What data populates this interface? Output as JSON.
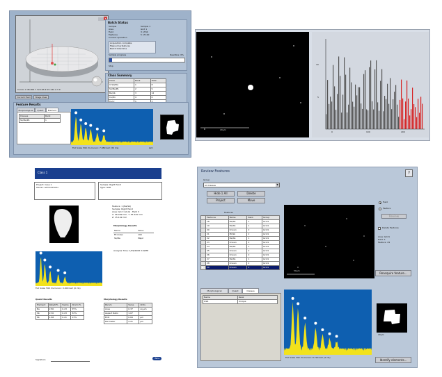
{
  "q1": {
    "batch_status": {
      "title": "Batch Status",
      "rows": [
        {
          "k": "Sample",
          "v": "Sample 1"
        },
        {
          "k": "Area",
          "v": "Grid 1"
        },
        {
          "k": "Field",
          "v": "3 of 84"
        },
        {
          "k": "Features",
          "v": "5 of 100"
        },
        {
          "k": "Current operation",
          "v": ""
        }
      ],
      "lines": [
        "Acquisition complete",
        "Measuring features",
        "Batch total time"
      ],
      "progress_label": "Sample progress",
      "deadline": "Deadline: 0%",
      "stop": "Stop"
    },
    "class_summary": {
      "title": "Class Summary",
      "headers": [
        "Class",
        "Rank",
        "Total"
      ],
      "rows": [
        [
          "U-Sb(Pb)",
          "1",
          "8"
        ],
        [
          "Sb/Ba/Pb",
          "2",
          "9"
        ],
        [
          "Ba/Sb",
          "3",
          "12"
        ],
        [
          "Cu/Zn",
          "4",
          "6"
        ],
        [
          "Fe/Cr",
          "5",
          "3"
        ]
      ]
    },
    "status_text": "Cursor  X 46.000  Y 32.163  Z 15.142  2.3  0",
    "buttons": [
      "Current Field",
      "Stage View"
    ],
    "feature_results": {
      "title": "Feature Results",
      "tabs": [
        "Morphological",
        "Quant",
        "Element"
      ],
      "headers": [
        "Classes",
        "Rank"
      ],
      "rows": [
        [
          "Sb/Ba/Pb",
          "1"
        ]
      ],
      "spectrum_caption": "Full Scale 590 cts  Cursor: 7.989 keV (30 cts)",
      "spectrum_unit": "keV"
    }
  },
  "q2": {
    "scale_bar": "20µm",
    "hist_x_ticks": [
      "0",
      "100",
      "200"
    ],
    "hist_y_ticks": [
      "10",
      "5"
    ]
  },
  "q3": {
    "header": "Class 1",
    "left_box": [
      "Project: Case 1",
      "Owner: administrator"
    ],
    "right_box": [
      "Sample: Right Hand",
      "Type: GSR"
    ],
    "details": [
      "Feature: 1 (Ba/Sb)",
      "Sample: Right Hand",
      "Area: Grid 1 (0,0) · Field 3",
      "X: 56.469 mm, Y: 45.220 mm",
      "Z: 15.142 mm"
    ],
    "morph_title": "Morphology Results",
    "morph_headers": [
      "Name",
      "Value"
    ],
    "morph_rows": [
      [
        "Fit Index",
        "100"
      ],
      [
        "Sb/Ba",
        "Major"
      ]
    ],
    "analysis_line": "Analysis Time: 1/09/2008 3:02PM",
    "spectrum_caption": "Full Scale 590 cts  Cursor: 0.000 keV (0 cts)",
    "quant_title": "Quant Results",
    "quant_headers": [
      "Element",
      "Weight%",
      "Sigma",
      "Atomic%"
    ],
    "quant_rows": [
      [
        "Ba",
        "2.80",
        "0.23",
        "55%"
      ],
      [
        "Sb",
        "2.30",
        "0.23",
        "32%"
      ],
      [
        "Pb",
        "1.88",
        "0.21",
        "13%"
      ]
    ],
    "morph2_title": "Morphology Results",
    "morph2_headers": [
      "Param",
      "Value",
      "Units"
    ],
    "morph2_rows": [
      [
        "Area",
        "0.37",
        "sq µm"
      ],
      [
        "Aspect Ratio",
        "1.07",
        ""
      ],
      [
        "ECD",
        "0.69",
        "µm"
      ],
      [
        "Perimeter",
        "2.21",
        "µm"
      ]
    ],
    "signature": "Signature",
    "footer_badge": "INCA"
  },
  "q4": {
    "title": "Review Features",
    "group_label": "Group",
    "group_value": "All Classes",
    "buttons": [
      "Hide 1 All",
      "Delete",
      "Project",
      "Move"
    ],
    "features_label": "Features",
    "table_headers": [
      "Features",
      "Name",
      "Rank",
      "Group"
    ],
    "table_rows": [
      [
        "18",
        "Ba/Sb",
        "1",
        "Grid1"
      ],
      [
        "19",
        "Ba/Sb",
        "1",
        "Grid1"
      ],
      [
        "20",
        "Known",
        "2",
        "Grid1"
      ],
      [
        "21",
        "Pb/Sb",
        "2",
        "Grid1"
      ],
      [
        "22",
        "Ba/Sb",
        "1",
        "Grid1"
      ],
      [
        "23",
        "Known",
        "2",
        "Grid1"
      ],
      [
        "24",
        "Ba/Sb",
        "1",
        "Grid1"
      ],
      [
        "25",
        "Known",
        "2",
        "Grid1"
      ],
      [
        "26",
        "Known",
        "2",
        "Grid1"
      ],
      [
        "27",
        "Ba/Sb",
        "1",
        "Grid1"
      ],
      [
        "28",
        "Known",
        "2",
        "Grid1"
      ],
      [
        "29",
        "Known",
        "2",
        "Grid1"
      ]
    ],
    "radio_field": "Field",
    "radio_feature": "Feature",
    "review_btn": "Review",
    "delete_features": "Delete Features",
    "info_lines": [
      "Area: Grid1",
      "Field: 1",
      "Feature: 29"
    ],
    "scale_bar": "50µm",
    "reacquire_btn": "Reacquire feature...",
    "tabs": [
      "Morphological",
      "Quant",
      "Classes"
    ],
    "class_headers": [
      "Name",
      "Rank"
    ],
    "class_rows": [
      [
        "GSR",
        "Unique"
      ]
    ],
    "spectrum_caption": "Full Scale 392 cts  Cursor: 8.729 keV (4 cts)",
    "feature_scale": "20µm",
    "identify_btn": "Identify elements..."
  }
}
